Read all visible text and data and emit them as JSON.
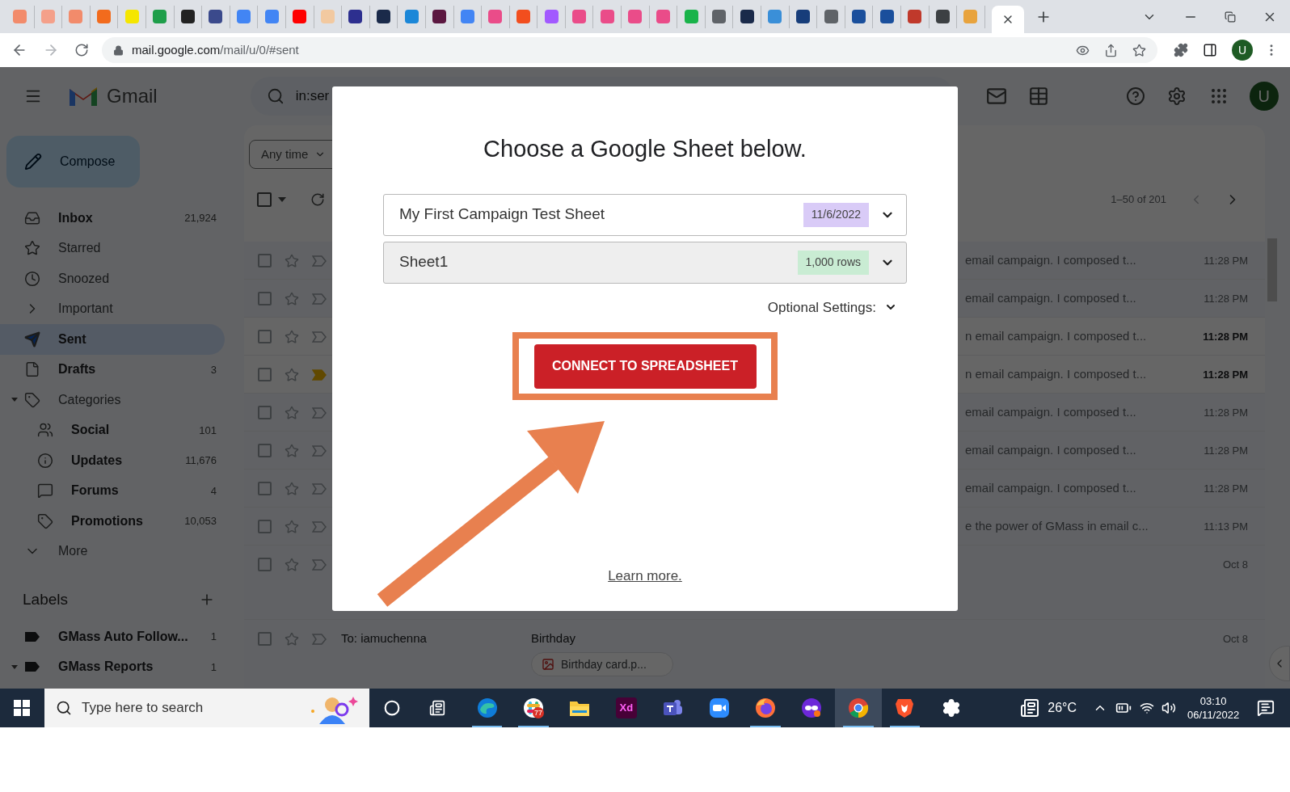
{
  "browser": {
    "tabs": [
      {
        "color": "#f28b6b",
        "selected": false
      },
      {
        "color": "#f4a08a",
        "selected": false
      },
      {
        "color": "#f28b6b",
        "selected": false
      },
      {
        "color": "#f26b1d",
        "selected": false
      },
      {
        "color": "#f5e600",
        "selected": false
      },
      {
        "color": "#1e9e4a",
        "selected": false
      },
      {
        "color": "#222222",
        "selected": false
      },
      {
        "color": "#3b4a8c",
        "selected": false
      },
      {
        "color": "#4285f4",
        "selected": false
      },
      {
        "color": "#4285f4",
        "selected": false
      },
      {
        "color": "#ff0000",
        "selected": false
      },
      {
        "color": "#f2c9a0",
        "selected": false
      },
      {
        "color": "#2d2f8f",
        "selected": false
      },
      {
        "color": "#1a2a4a",
        "selected": false
      },
      {
        "color": "#1b87d8",
        "selected": false
      },
      {
        "color": "#5b1740",
        "selected": false
      },
      {
        "color": "#4285f4",
        "selected": false
      },
      {
        "color": "#ea4c89",
        "selected": false
      },
      {
        "color": "#f24e1e",
        "selected": false
      },
      {
        "color": "#a259ff",
        "selected": false
      },
      {
        "color": "#ea4c89",
        "selected": false
      },
      {
        "color": "#ea4c89",
        "selected": false
      },
      {
        "color": "#ea4c89",
        "selected": false
      },
      {
        "color": "#ea4c89",
        "selected": false
      },
      {
        "color": "#19b34a",
        "selected": false
      },
      {
        "color": "#5f6368",
        "selected": false
      },
      {
        "color": "#1a2a4a",
        "selected": false
      },
      {
        "color": "#3a8fd8",
        "selected": false
      },
      {
        "color": "#173d7a",
        "selected": false
      },
      {
        "color": "#5f6368",
        "selected": false
      },
      {
        "color": "#1a4f9c",
        "selected": false
      },
      {
        "color": "#1a4f9c",
        "selected": false
      },
      {
        "color": "#c0392b",
        "selected": false
      },
      {
        "color": "#3c4043",
        "selected": false
      },
      {
        "color": "#e8a33d",
        "selected": false
      },
      {
        "selected": true
      }
    ],
    "address": {
      "host": "mail.google.com",
      "path": "/mail/u/0/#sent"
    },
    "profile": "U"
  },
  "gmail": {
    "app_name": "Gmail",
    "search": {
      "value": "in:ser"
    },
    "avatar": "U",
    "compose": "Compose",
    "nav": [
      {
        "label": "Inbox",
        "count": "21,924",
        "bold": true,
        "selected": false
      },
      {
        "label": "Starred",
        "bold": false,
        "selected": false
      },
      {
        "label": "Snoozed",
        "bold": false,
        "selected": false
      },
      {
        "label": "Important",
        "bold": false,
        "selected": false
      },
      {
        "label": "Sent",
        "bold": true,
        "selected": true
      },
      {
        "label": "Drafts",
        "count": "3",
        "bold": true,
        "selected": false
      },
      {
        "label": "Categories",
        "bold": false,
        "selected": false,
        "expanded": true,
        "children": [
          {
            "label": "Social",
            "count": "101",
            "bold": true,
            "selected": false
          },
          {
            "label": "Updates",
            "count": "11,676",
            "bold": true,
            "selected": false
          },
          {
            "label": "Forums",
            "count": "4",
            "bold": true,
            "selected": false
          },
          {
            "label": "Promotions",
            "count": "10,053",
            "bold": true,
            "selected": false
          }
        ]
      },
      {
        "label": "More",
        "bold": false,
        "selected": false
      }
    ],
    "labels_heading": "Labels",
    "labels": [
      {
        "label": "GMass Auto Follow...",
        "count": "1",
        "expanded": false
      },
      {
        "label": "GMass Reports",
        "count": "1",
        "expanded": true
      }
    ],
    "filter": "Any time",
    "select_all": {
      "checked": false
    },
    "pagination": "1–50 of 201",
    "rows": [
      {
        "kind": "plain",
        "snippet": "email campaign. I composed t...",
        "time": "11:28 PM",
        "unread": false,
        "important": false
      },
      {
        "kind": "plain",
        "snippet": "email campaign. I composed t...",
        "time": "11:28 PM",
        "unread": false,
        "important": false
      },
      {
        "kind": "plain",
        "snippet": "n email campaign. I composed t...",
        "time": "11:28 PM",
        "unread": true,
        "important": false
      },
      {
        "kind": "plain",
        "snippet": "n email campaign. I composed t...",
        "time": "11:28 PM",
        "unread": true,
        "important": true
      },
      {
        "kind": "plain",
        "snippet": "email campaign. I composed t...",
        "time": "11:28 PM",
        "unread": false,
        "important": false
      },
      {
        "kind": "plain",
        "snippet": "email campaign. I composed t...",
        "time": "11:28 PM",
        "unread": false,
        "important": false
      },
      {
        "kind": "plain",
        "snippet": "email campaign. I composed t...",
        "time": "11:28 PM",
        "unread": false,
        "important": false
      },
      {
        "kind": "plain",
        "snippet": "e the power of GMass in email c...",
        "time": "11:13 PM",
        "unread": false,
        "important": false
      },
      {
        "kind": "attachment",
        "time": "Oct 8",
        "unread": false,
        "important": false
      },
      {
        "kind": "attachment",
        "to": "To: iamuchenna",
        "subject": "Birthday",
        "attachment": "Birthday card.p...",
        "time": "Oct 8",
        "unread": false,
        "important": false
      }
    ]
  },
  "dialog": {
    "title": "Choose a Google Sheet below.",
    "selects": [
      {
        "kind": "spreadsheet",
        "value": "My First Campaign Test Sheet",
        "badge": "11/6/2022",
        "color": "#d9cbf7"
      },
      {
        "kind": "sheet",
        "value": "Sheet1",
        "badge": "1,000 rows",
        "color": "#c9ecd3"
      }
    ],
    "optional": "Optional Settings:",
    "button": "CONNECT TO SPREADSHEET",
    "highlighted": true,
    "link": "Learn more."
  },
  "taskbar": {
    "search_placeholder": "Type here to search",
    "apps": [
      {
        "kind": "edge",
        "running": true,
        "selected": false
      },
      {
        "kind": "slack",
        "badge": "77",
        "running": true,
        "selected": false
      },
      {
        "kind": "explorer",
        "running": false,
        "selected": false
      },
      {
        "kind": "xd",
        "text": "Xd",
        "running": false,
        "selected": false
      },
      {
        "kind": "teams",
        "running": false,
        "selected": false
      },
      {
        "kind": "zoom",
        "running": false,
        "selected": false
      },
      {
        "kind": "firefox",
        "running": true,
        "selected": false
      },
      {
        "kind": "mask",
        "running": false,
        "selected": false
      },
      {
        "kind": "chrome",
        "running": true,
        "selected": true
      },
      {
        "kind": "brave",
        "running": true,
        "selected": false
      },
      {
        "kind": "settings",
        "running": false,
        "selected": false
      }
    ],
    "weather": "26°C",
    "time": "03:10",
    "date": "06/11/2022"
  }
}
